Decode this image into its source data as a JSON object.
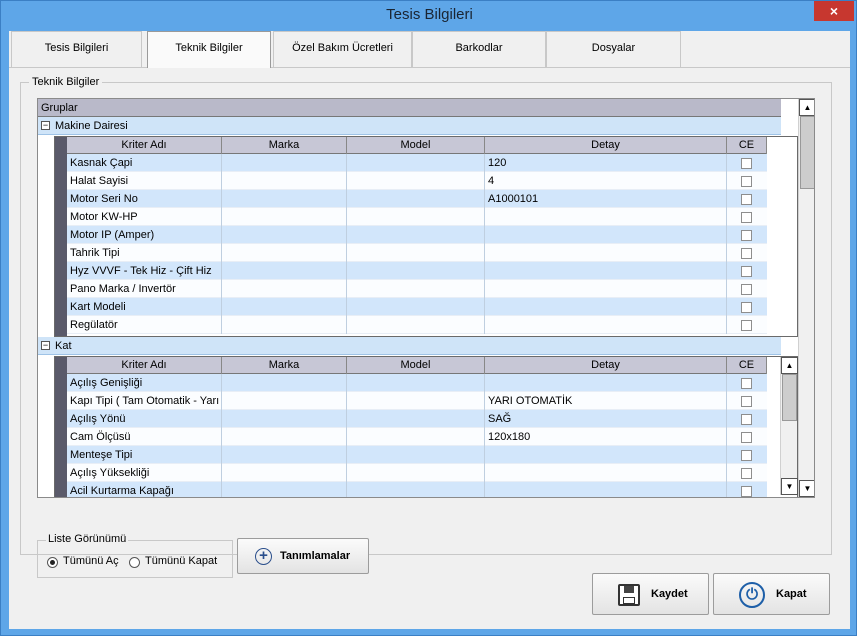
{
  "window": {
    "title": "Tesis Bilgileri",
    "close": "×"
  },
  "tabs": [
    "Tesis Bilgileri",
    "Teknik Bilgiler",
    "Özel Bakım Ücretleri",
    "Barkodlar",
    "Dosyalar"
  ],
  "group": {
    "label": "Teknik Bilgiler"
  },
  "grid": {
    "header": "Gruplar",
    "columns": [
      "Kriter Adı",
      "Marka",
      "Model",
      "Detay",
      "CE"
    ],
    "groups": [
      {
        "name": "Makine Dairesi",
        "expander": "−",
        "rows": [
          [
            "Kasnak Çapi",
            "",
            "",
            "120"
          ],
          [
            "Halat Sayisi",
            "",
            "",
            "4"
          ],
          [
            "Motor Seri No",
            "",
            "",
            "A1000101"
          ],
          [
            "Motor KW-HP",
            "",
            "",
            ""
          ],
          [
            "Motor IP (Amper)",
            "",
            "",
            ""
          ],
          [
            "Tahrik Tipi",
            "",
            "",
            ""
          ],
          [
            "Hyz VVVF - Tek Hiz - Çift Hiz",
            "",
            "",
            ""
          ],
          [
            "Pano Marka / Invertör",
            "",
            "",
            ""
          ],
          [
            "Kart Modeli",
            "",
            "",
            ""
          ],
          [
            "Regülatör",
            "",
            "",
            ""
          ]
        ]
      },
      {
        "name": "Kat",
        "expander": "−",
        "rows": [
          [
            "Açılış Genişliği",
            "",
            "",
            ""
          ],
          [
            "Kapı Tipi ( Tam Otomatik - Yarı Otomatik )",
            "",
            "",
            "YARI OTOMATİK"
          ],
          [
            "Açılış Yönü",
            "",
            "",
            "SAĞ"
          ],
          [
            "Cam Ölçüsü",
            "",
            "",
            "120x180"
          ],
          [
            "Menteşe Tipi",
            "",
            "",
            ""
          ],
          [
            "Açılış Yüksekliği",
            "",
            "",
            ""
          ],
          [
            "Acil Kurtarma Kapağı",
            "",
            "",
            ""
          ]
        ]
      }
    ]
  },
  "list_view": {
    "label": "Liste Görünümü",
    "options": [
      "Tümünü Aç",
      "Tümünü Kapat"
    ],
    "selected": 0
  },
  "buttons": {
    "definitions": "Tanımlamalar",
    "save": "Kaydet",
    "close": "Kapat"
  },
  "icons": {
    "definitions": "plus-circle-icon",
    "save": "floppy-disk-icon",
    "close": "power-icon"
  }
}
